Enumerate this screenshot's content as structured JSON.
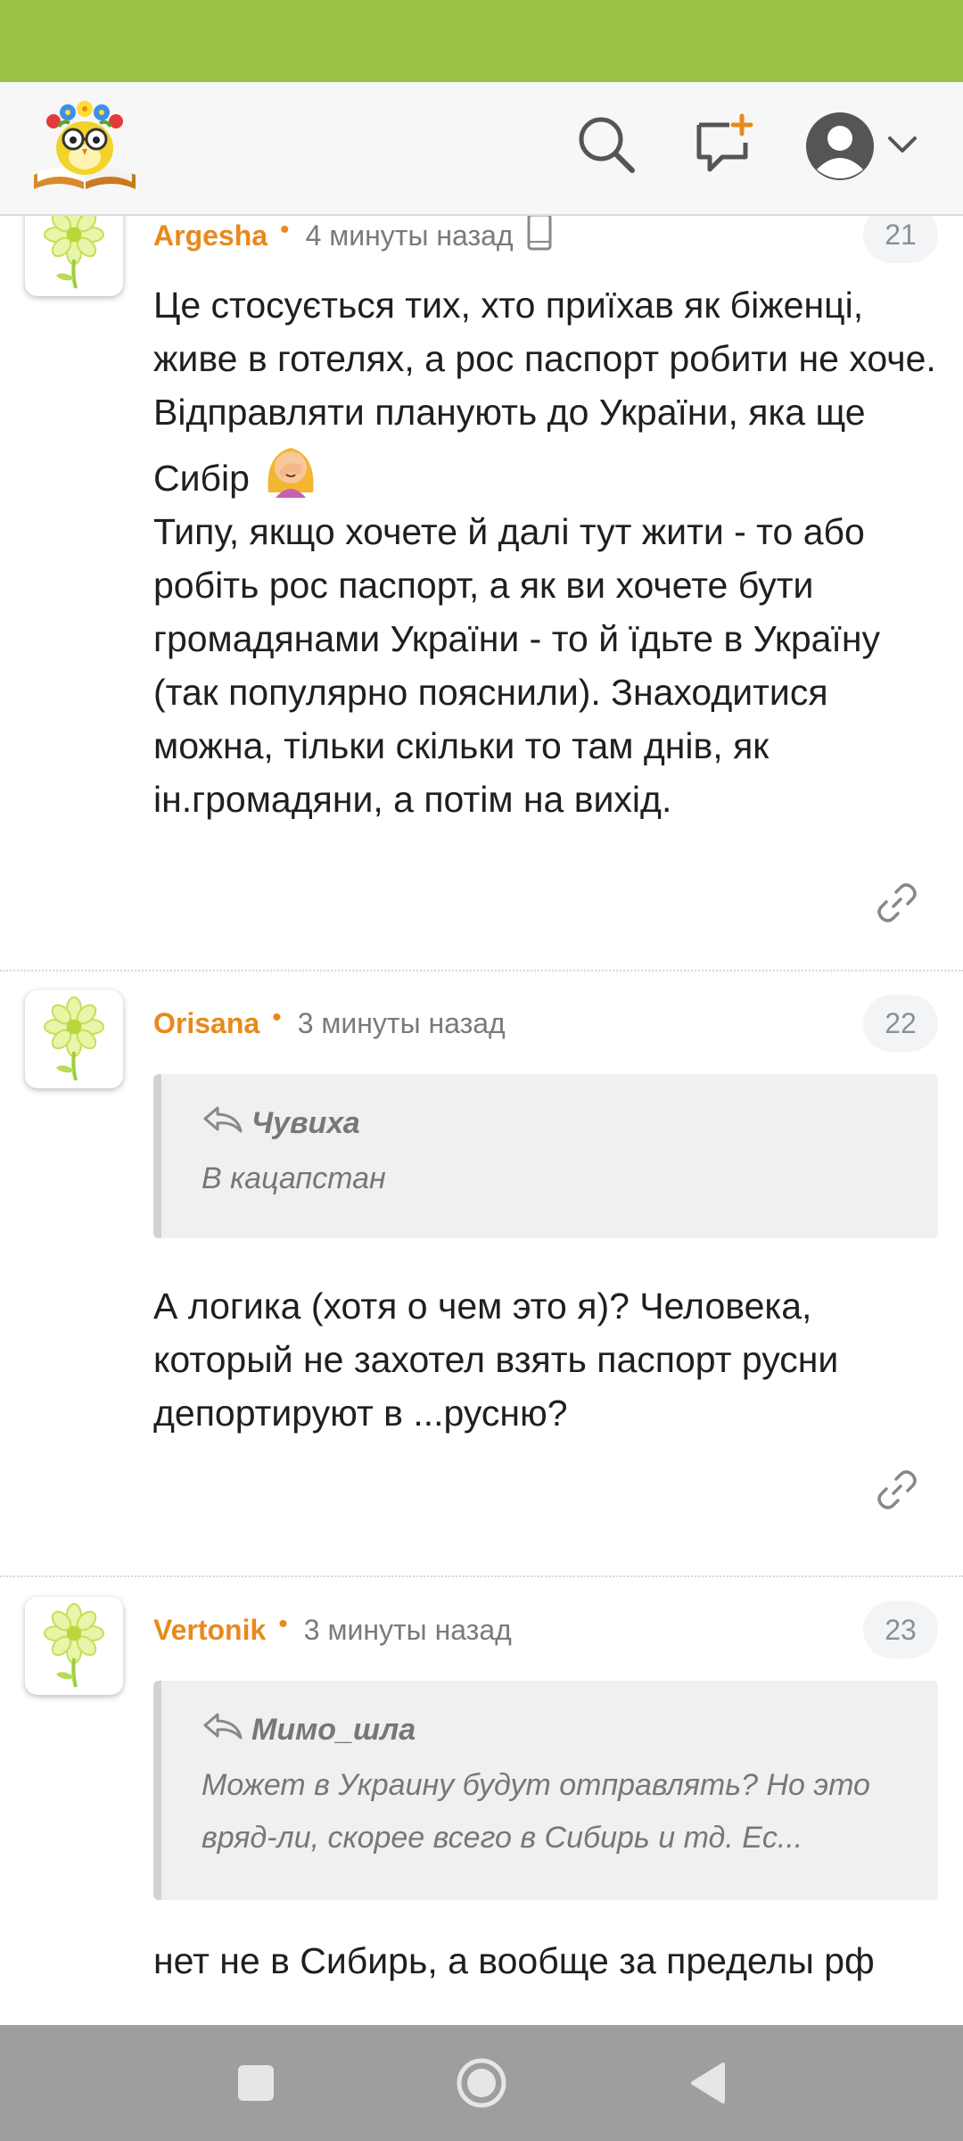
{
  "header": {
    "logo_icon": "reading-owl-logo-icon",
    "search_icon": "search-icon",
    "new_comment_icon": "add-message-icon",
    "profile_icon": "user-avatar-icon",
    "dropdown_icon": "chevron-down-icon",
    "accent_color": "#9dc142"
  },
  "comments": [
    {
      "author": "Argesha",
      "time": "4 минуты назад",
      "device_icon": "mobile-phone-icon",
      "number": "21",
      "body": [
        "Це стосується тих, хто приїхав як біженці, живе в готелях, а рос паспорт робити не хоче. Відправляти планують до України, яка ще Сибір",
        "Типу, якщо хочете й далі тут жити - то або робіть рос паспорт, а як ви хочете бути громадянами України - то й їдьте в Україну (так популярно пояснили). Знаходитися можна, тільки скільки то там днів, як ін.громадяни, а потім на вихід."
      ],
      "emoji": "🤦‍♀️"
    },
    {
      "author": "Orisana",
      "time": "3 минуты назад",
      "number": "22",
      "quote": {
        "author": "Чувиха",
        "text": "В кацапстан"
      },
      "body": "А логика (хотя о чем это я)? Человека, который не захотел взять паспорт русни депортируют в ...русню?"
    },
    {
      "author": "Vertonik",
      "time": "3 минуты назад",
      "number": "23",
      "quote": {
        "author": "Мимо_шла",
        "text_line1": "Может в Украину будут отправлять? Но это",
        "text_line2": "вряд-ли, скорее всего в Сибирь и тд. Ес..."
      },
      "body": "нет не в Сибирь, а вообще за пределы рф"
    }
  ],
  "colors": {
    "author": "#e8891c",
    "status_bar": "#9dc142",
    "nav_bar": "#9e9e9e"
  },
  "nav": {
    "recents_icon": "square-recents-icon",
    "home_icon": "circle-home-icon",
    "back_icon": "triangle-back-icon"
  }
}
